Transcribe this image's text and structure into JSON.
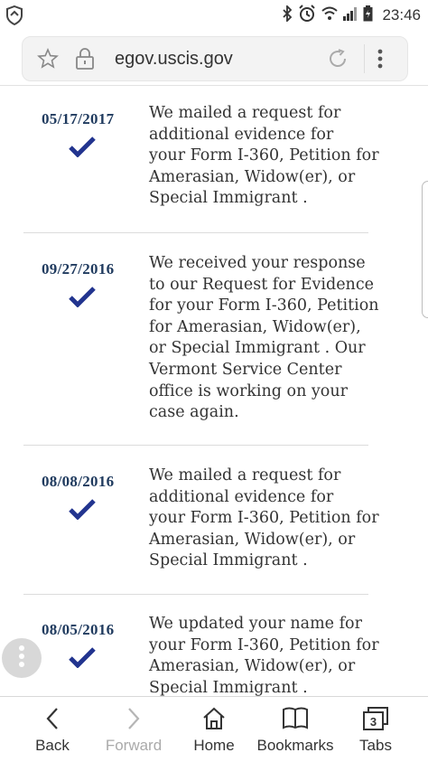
{
  "status_bar": {
    "time": "23:46",
    "icons": [
      "shield-icon",
      "bluetooth-icon",
      "alarm-icon",
      "wifi-icon",
      "signal-icon",
      "battery-icon"
    ]
  },
  "address_bar": {
    "url": "egov.uscis.gov",
    "icons": [
      "star-icon",
      "lock-icon",
      "reload-icon",
      "more-vert-icon"
    ]
  },
  "history": [
    {
      "date": "05/17/2017",
      "lines": [
        "We mailed a request for",
        "additional evidence for",
        "your Form I-360, Petition for",
        "Amerasian, Widow(er), or",
        "Special Immigrant ."
      ]
    },
    {
      "date": "09/27/2016",
      "lines": [
        "We received your response",
        "to our Request for Evidence",
        "for your Form I-360, Petition",
        "for Amerasian, Widow(er),",
        "or Special Immigrant . Our",
        "Vermont Service Center",
        "office is working on your",
        "case again."
      ]
    },
    {
      "date": "08/08/2016",
      "lines": [
        "We mailed a request for",
        "additional evidence for",
        "your Form I-360, Petition for",
        "Amerasian, Widow(er), or",
        "Special Immigrant ."
      ]
    },
    {
      "date": "08/05/2016",
      "lines": [
        "We updated your name for",
        "your Form I-360, Petition for",
        "Amerasian, Widow(er), or",
        "Special Immigrant ."
      ]
    }
  ],
  "bottom_nav": {
    "back": "Back",
    "forward": "Forward",
    "home": "Home",
    "bookmarks": "Bookmarks",
    "tabs": "Tabs",
    "tab_count": "3"
  },
  "colors": {
    "date": "#1f3a5e",
    "check": "#22348f",
    "text": "#333333"
  }
}
